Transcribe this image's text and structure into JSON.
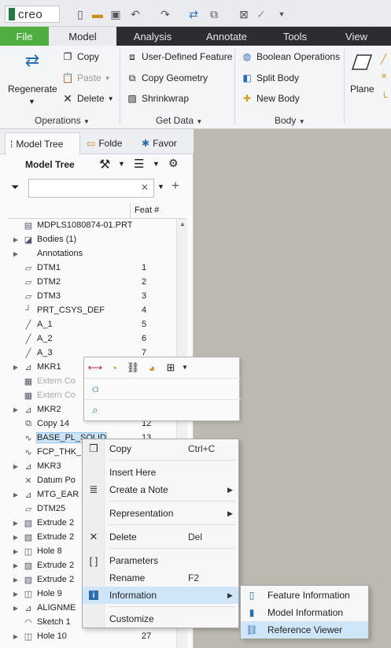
{
  "app": {
    "logo_text": "creo"
  },
  "quick_access": [
    "new-file-icon",
    "open-folder-icon",
    "save-icon",
    "undo-icon",
    "redo-icon",
    "regenerate-icon",
    "windows-icon",
    "close-icon",
    "check-icon",
    "dropdown-icon"
  ],
  "tabs": [
    {
      "label": "File"
    },
    {
      "label": "Model"
    },
    {
      "label": "Analysis"
    },
    {
      "label": "Annotate"
    },
    {
      "label": "Tools"
    },
    {
      "label": "View"
    }
  ],
  "ribbon": {
    "regenerate": "Regenerate",
    "copy": "Copy",
    "paste": "Paste",
    "delete": "Delete",
    "operations": "Operations",
    "udf": "User-Defined Feature",
    "copy_geometry": "Copy Geometry",
    "shrinkwrap": "Shrinkwrap",
    "get_data": "Get Data",
    "boolean": "Boolean Operations",
    "split_body": "Split Body",
    "new_body": "New Body",
    "body": "Body",
    "plane": "Plane"
  },
  "navigator": {
    "tabs": [
      "Model Tree",
      "Folde",
      "Favor"
    ],
    "tree_title": "Model Tree",
    "search_placeholder": "",
    "feat_col": "Feat #"
  },
  "tree": [
    {
      "label": "MDPLS1080874-01.PRT",
      "feat": "",
      "icon": "part-icon",
      "exp": ""
    },
    {
      "label": "Bodies (1)",
      "feat": "",
      "icon": "bodies-icon",
      "exp": "▶"
    },
    {
      "label": "Annotations",
      "feat": "",
      "icon": "",
      "exp": "▶"
    },
    {
      "label": "DTM1",
      "feat": "1",
      "icon": "datum-plane-icon",
      "exp": ""
    },
    {
      "label": "DTM2",
      "feat": "2",
      "icon": "datum-plane-icon",
      "exp": ""
    },
    {
      "label": "DTM3",
      "feat": "3",
      "icon": "datum-plane-icon",
      "exp": ""
    },
    {
      "label": "PRT_CSYS_DEF",
      "feat": "4",
      "icon": "csys-icon",
      "exp": ""
    },
    {
      "label": "A_1",
      "feat": "5",
      "icon": "axis-icon",
      "exp": ""
    },
    {
      "label": "A_2",
      "feat": "6",
      "icon": "axis-icon",
      "exp": ""
    },
    {
      "label": "A_3",
      "feat": "7",
      "icon": "axis-icon",
      "exp": ""
    },
    {
      "label": "MKR1",
      "feat": "",
      "icon": "marker-icon",
      "exp": "▶"
    },
    {
      "label": "Extern Co",
      "feat": "",
      "icon": "extern-copy-icon",
      "exp": "",
      "grey": true
    },
    {
      "label": "Extern Co",
      "feat": "",
      "icon": "extern-copy-icon",
      "exp": "",
      "grey": true
    },
    {
      "label": "MKR2",
      "feat": "",
      "icon": "marker-icon",
      "exp": "▶"
    },
    {
      "label": "Copy 14",
      "feat": "12",
      "icon": "copy-feature-icon",
      "exp": ""
    },
    {
      "label": "BASE_PL_SOLID",
      "feat": "13",
      "icon": "curve-icon",
      "exp": "",
      "sel": true
    },
    {
      "label": "FCP_THK_",
      "feat": "",
      "icon": "curve-icon",
      "exp": ""
    },
    {
      "label": "MKR3",
      "feat": "",
      "icon": "marker-icon",
      "exp": "▶"
    },
    {
      "label": "Datum Po",
      "feat": "",
      "icon": "datum-point-icon",
      "exp": ""
    },
    {
      "label": "MTG_EAR",
      "feat": "",
      "icon": "marker-icon",
      "exp": "▶"
    },
    {
      "label": "DTM25",
      "feat": "",
      "icon": "datum-plane-icon",
      "exp": ""
    },
    {
      "label": "Extrude 2",
      "feat": "",
      "icon": "extrude-icon",
      "exp": "▶"
    },
    {
      "label": "Extrude 2",
      "feat": "",
      "icon": "extrude-icon",
      "exp": "▶"
    },
    {
      "label": "Hole 8",
      "feat": "",
      "icon": "hole-icon",
      "exp": "▶"
    },
    {
      "label": "Extrude 2",
      "feat": "",
      "icon": "extrude-icon",
      "exp": "▶"
    },
    {
      "label": "Extrude 2",
      "feat": "",
      "icon": "extrude-icon",
      "exp": "▶"
    },
    {
      "label": "Hole 9",
      "feat": "",
      "icon": "hole-icon",
      "exp": "▶"
    },
    {
      "label": "ALIGNME",
      "feat": "",
      "icon": "marker-icon",
      "exp": "▶"
    },
    {
      "label": "Sketch 1",
      "feat": "",
      "icon": "sketch-icon",
      "exp": ""
    },
    {
      "label": "Hole 10",
      "feat": "27",
      "icon": "hole-icon",
      "exp": "▶"
    }
  ],
  "minibar": {
    "row1": [
      "dimension-icon",
      "appearance-icon",
      "chain-icon",
      "fill-icon",
      "select-filter-icon"
    ],
    "row2": [
      "edit-definition-icon"
    ],
    "row3": [
      "zoom-fit-icon"
    ]
  },
  "context_menu": [
    {
      "label": "Copy",
      "shortcut": "Ctrl+C",
      "icon": "copy-icon"
    },
    {
      "sep": true
    },
    {
      "label": "Insert Here",
      "shortcut": "",
      "icon": ""
    },
    {
      "label": "Create a Note",
      "shortcut": "",
      "icon": "note-icon",
      "arrow": true
    },
    {
      "sep": true
    },
    {
      "label": "Representation",
      "shortcut": "",
      "icon": "",
      "arrow": true
    },
    {
      "sep": true
    },
    {
      "label": "Delete",
      "shortcut": "Del",
      "icon": "delete-icon"
    },
    {
      "sep": true
    },
    {
      "label": "Parameters",
      "shortcut": "",
      "icon": "parameters-icon"
    },
    {
      "label": "Rename",
      "shortcut": "F2",
      "icon": ""
    },
    {
      "label": "Information",
      "shortcut": "",
      "icon": "info-icon",
      "arrow": true,
      "hl": true
    },
    {
      "sep": true
    },
    {
      "label": "Customize",
      "shortcut": "",
      "icon": ""
    }
  ],
  "submenu": [
    {
      "label": "Feature Information",
      "icon": "feature-info-icon"
    },
    {
      "label": "Model Information",
      "icon": "model-info-icon"
    },
    {
      "label": "Reference Viewer",
      "icon": "reference-viewer-icon",
      "hl": true
    }
  ]
}
